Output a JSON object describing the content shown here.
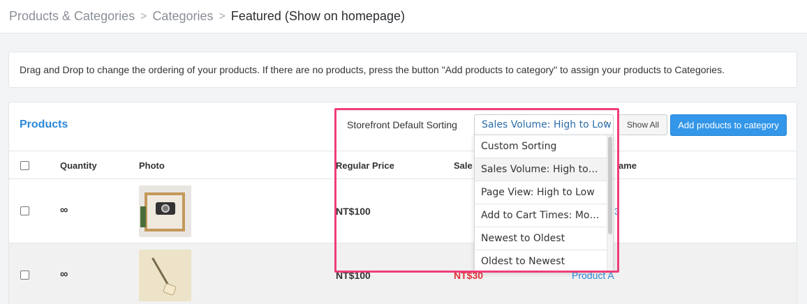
{
  "breadcrumb": {
    "items": [
      "Products & Categories",
      "Categories"
    ],
    "separator": ">",
    "current": "Featured (Show on homepage)"
  },
  "info": {
    "text": "Drag and Drop to change the ordering of your products. If there are no products, press the button \"Add products to category\" to assign your products to Categories."
  },
  "panel": {
    "title": "Products",
    "sort_label": "Storefront Default Sorting",
    "sort_selected": "Sales Volume: High to Low",
    "show_all_label": "Show All",
    "add_button_label": "Add products to category"
  },
  "table": {
    "headers": {
      "quantity": "Quantity",
      "photo": "Photo",
      "regular_price": "Regular Price",
      "sale_price": "Sale",
      "name": "ame"
    },
    "rows": [
      {
        "quantity": "∞",
        "regular_price": "NT$100",
        "sale_price": "",
        "name": "3"
      },
      {
        "quantity": "∞",
        "regular_price": "NT$100",
        "sale_price": "NT$30",
        "name": "Product A"
      }
    ]
  },
  "dropdown": {
    "options": [
      "Custom Sorting",
      "Sales Volume: High to Low",
      "Page View: High to Low",
      "Add to Cart Times: More to Less",
      "Newest to Oldest",
      "Oldest to Newest"
    ],
    "selected_index": 1
  },
  "colors": {
    "accent": "#2b87d7",
    "primary_button": "#3396e8",
    "sale_price": "#e0313a",
    "highlight_border": "#ee3e78"
  }
}
